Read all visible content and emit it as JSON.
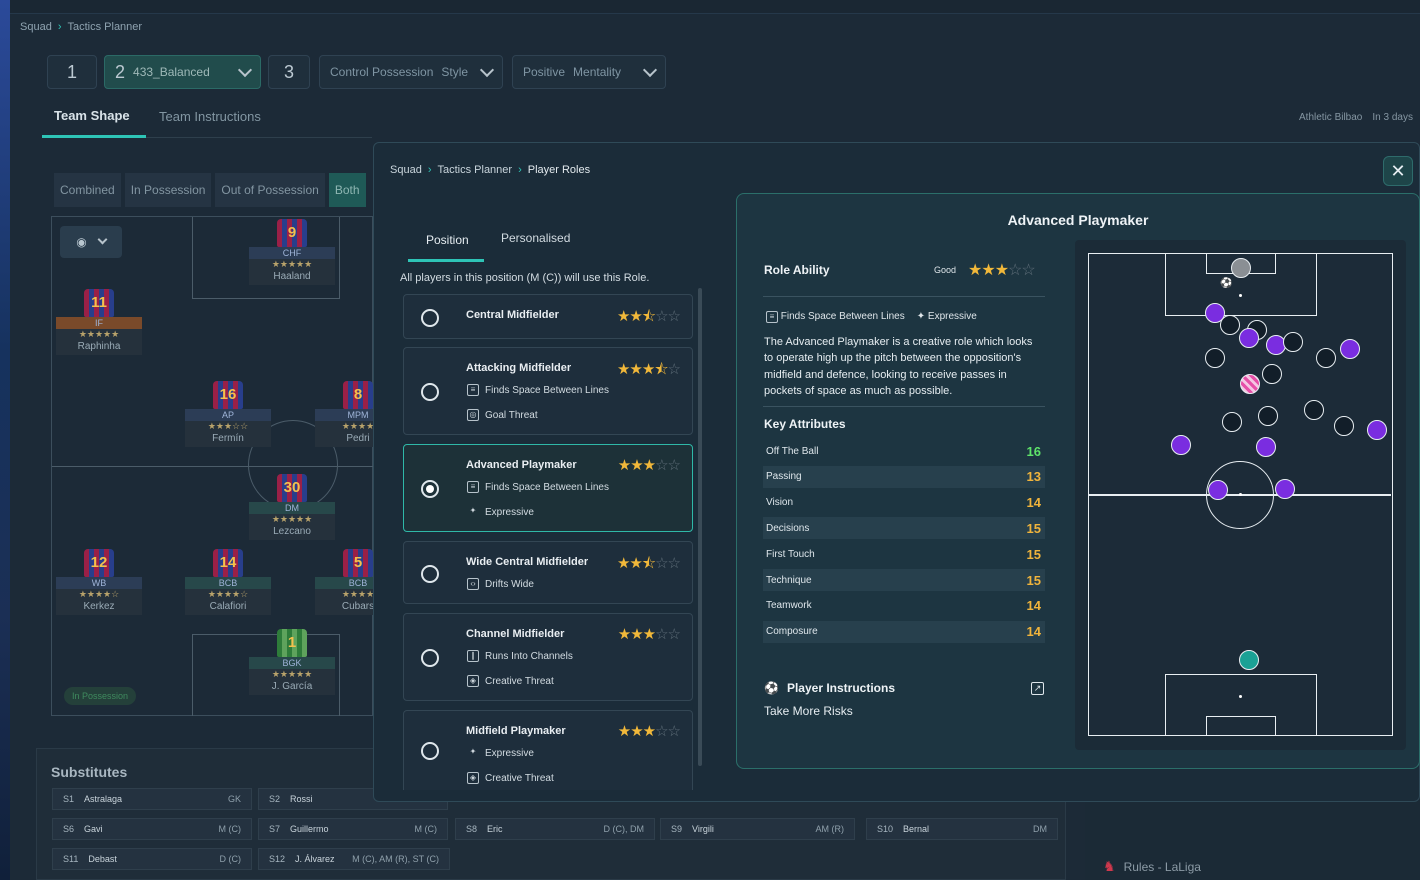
{
  "breadcrumb": {
    "a": "Squad",
    "b": "Tactics Planner"
  },
  "tactics": {
    "slot1": "1",
    "slot2": "2",
    "formation": "433_Balanced",
    "slot3": "3",
    "style_value": "Control Possession",
    "style_label": "Style",
    "mentality_value": "Positive",
    "mentality_label": "Mentality"
  },
  "tabs": {
    "shape": "Team Shape",
    "instructions": "Team Instructions"
  },
  "match": {
    "opponent": "Athletic Bilbao",
    "when": "In 3 days"
  },
  "phase": {
    "combined": "Combined",
    "in_pos": "In Possession",
    "out_pos": "Out of Possession",
    "both": "Both"
  },
  "pitch_badge": "In Possession",
  "players": [
    {
      "num": "9",
      "pos": "CHF",
      "stars": "★★★★★",
      "name": "Haaland"
    },
    {
      "num": "11",
      "pos": "IF",
      "stars": "★★★★★",
      "name": "Raphinha"
    },
    {
      "num": "16",
      "pos": "AP",
      "stars": "★★★☆☆",
      "name": "Fermín"
    },
    {
      "num": "8",
      "pos": "MPM",
      "stars": "★★★★",
      "name": "Pedri"
    },
    {
      "num": "30",
      "pos": "DM",
      "stars": "★★★★★",
      "name": "Lezcano"
    },
    {
      "num": "12",
      "pos": "WB",
      "stars": "★★★★☆",
      "name": "Kerkez"
    },
    {
      "num": "14",
      "pos": "BCB",
      "stars": "★★★★☆",
      "name": "Calafiori"
    },
    {
      "num": "5",
      "pos": "BCB",
      "stars": "★★★★",
      "name": "Cubars"
    },
    {
      "num": "1",
      "pos": "BGK",
      "stars": "★★★★★",
      "name": "J. García"
    }
  ],
  "subs": {
    "title": "Substitutes",
    "rows": [
      {
        "id": "S1",
        "name": "Astralaga",
        "pos": "GK"
      },
      {
        "id": "S2",
        "name": "Rossi",
        "pos": ""
      },
      {
        "id": "S6",
        "name": "Gavi",
        "pos": "M (C)"
      },
      {
        "id": "S7",
        "name": "Guillermo",
        "pos": "M (C)"
      },
      {
        "id": "S8",
        "name": "Eric",
        "pos": "D (C), DM"
      },
      {
        "id": "S9",
        "name": "Virgili",
        "pos": "AM (R)"
      },
      {
        "id": "S10",
        "name": "Bernal",
        "pos": "DM"
      },
      {
        "id": "S11",
        "name": "Debast",
        "pos": "D (C)"
      },
      {
        "id": "S12",
        "name": "J. Álvarez",
        "pos": "M (C), AM (R), ST (C)"
      }
    ]
  },
  "rules": "Rules - LaLiga",
  "modal": {
    "breadcrumb": {
      "a": "Squad",
      "b": "Tactics Planner",
      "c": "Player Roles"
    },
    "close": "✕",
    "tab_position": "Position",
    "tab_personalised": "Personalised",
    "note": "All players in this position (M (C)) will use this Role.",
    "roles": [
      {
        "name": "Central Midfielder",
        "stars": 2.5,
        "traits": []
      },
      {
        "name": "Attacking Midfielder",
        "stars": 3.5,
        "traits": [
          "Finds Space Between Lines",
          "Goal Threat"
        ]
      },
      {
        "name": "Advanced Playmaker",
        "stars": 3,
        "traits": [
          "Finds Space Between Lines",
          "Expressive"
        ]
      },
      {
        "name": "Wide Central Midfielder",
        "stars": 2.5,
        "traits": [
          "Drifts Wide"
        ]
      },
      {
        "name": "Channel Midfielder",
        "stars": 3,
        "traits": [
          "Runs Into Channels",
          "Creative Threat"
        ]
      },
      {
        "name": "Midfield Playmaker",
        "stars": 3,
        "traits": [
          "Expressive",
          "Creative Threat"
        ]
      }
    ],
    "selected_role": "Advanced Playmaker"
  },
  "detail": {
    "title": "Advanced Playmaker",
    "ability_label": "Role Ability",
    "ability_word": "Good",
    "ability_stars": 3,
    "traits": [
      "Finds Space Between Lines",
      "Expressive"
    ],
    "description": "The Advanced Playmaker is a creative role which looks to operate high up the pitch between the opposition's midfield and defence, looking to receive passes in pockets of space as much as possible.",
    "key_title": "Key Attributes",
    "attributes": [
      {
        "name": "Off The Ball",
        "value": "16"
      },
      {
        "name": "Passing",
        "value": "13"
      },
      {
        "name": "Vision",
        "value": "14"
      },
      {
        "name": "Decisions",
        "value": "15"
      },
      {
        "name": "First Touch",
        "value": "15"
      },
      {
        "name": "Technique",
        "value": "15"
      },
      {
        "name": "Teamwork",
        "value": "14"
      },
      {
        "name": "Composure",
        "value": "14"
      }
    ],
    "pi_title": "Player Instructions",
    "pi_value": "Take More Risks"
  },
  "colors": {
    "accent": "#2ec4b6",
    "star": "#f1b83a",
    "attr_high": "#5ee36a",
    "attr": "#f0b43c",
    "team_dot": "#7a2de0"
  }
}
